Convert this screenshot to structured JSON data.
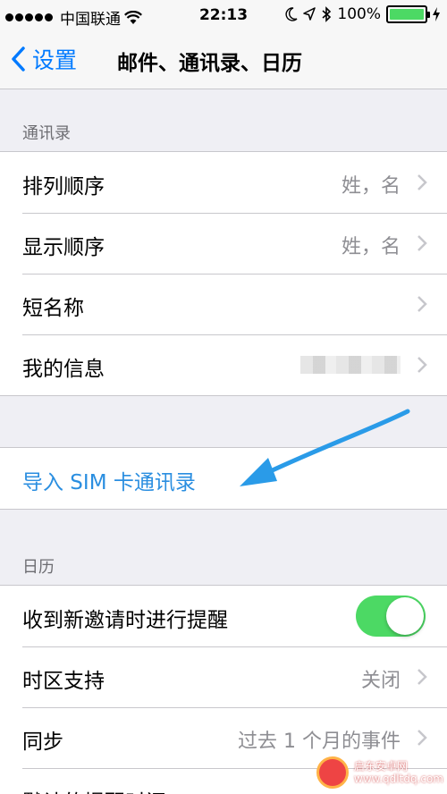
{
  "status_bar": {
    "carrier": "中国联通",
    "time": "22:13",
    "battery": "100%",
    "battery_level": 1.0
  },
  "nav": {
    "back_label": "设置",
    "title": "邮件、通讯录、日历"
  },
  "contacts": {
    "header": "通讯录",
    "rows": [
      {
        "label": "排列顺序",
        "value": "姓，名"
      },
      {
        "label": "显示顺序",
        "value": "姓，名"
      },
      {
        "label": "短名称",
        "value": ""
      },
      {
        "label": "我的信息",
        "value": ""
      }
    ]
  },
  "import_sim": {
    "label": "导入 SIM 卡通讯录"
  },
  "calendar": {
    "header": "日历",
    "rows": [
      {
        "label": "收到新邀请时进行提醒",
        "toggle_on": true
      },
      {
        "label": "时区支持",
        "value": "关闭"
      },
      {
        "label": "同步",
        "value": "过去 1 个月的事件"
      },
      {
        "label": "默认的提醒时间"
      }
    ]
  },
  "colors": {
    "accent": "#007aff",
    "link": "#2a8ee0",
    "toggle_on": "#4cd964",
    "arrow": "#2a9be8"
  },
  "watermark": {
    "line1": "启东安卓网",
    "line2": "www.qdltdq.com"
  }
}
